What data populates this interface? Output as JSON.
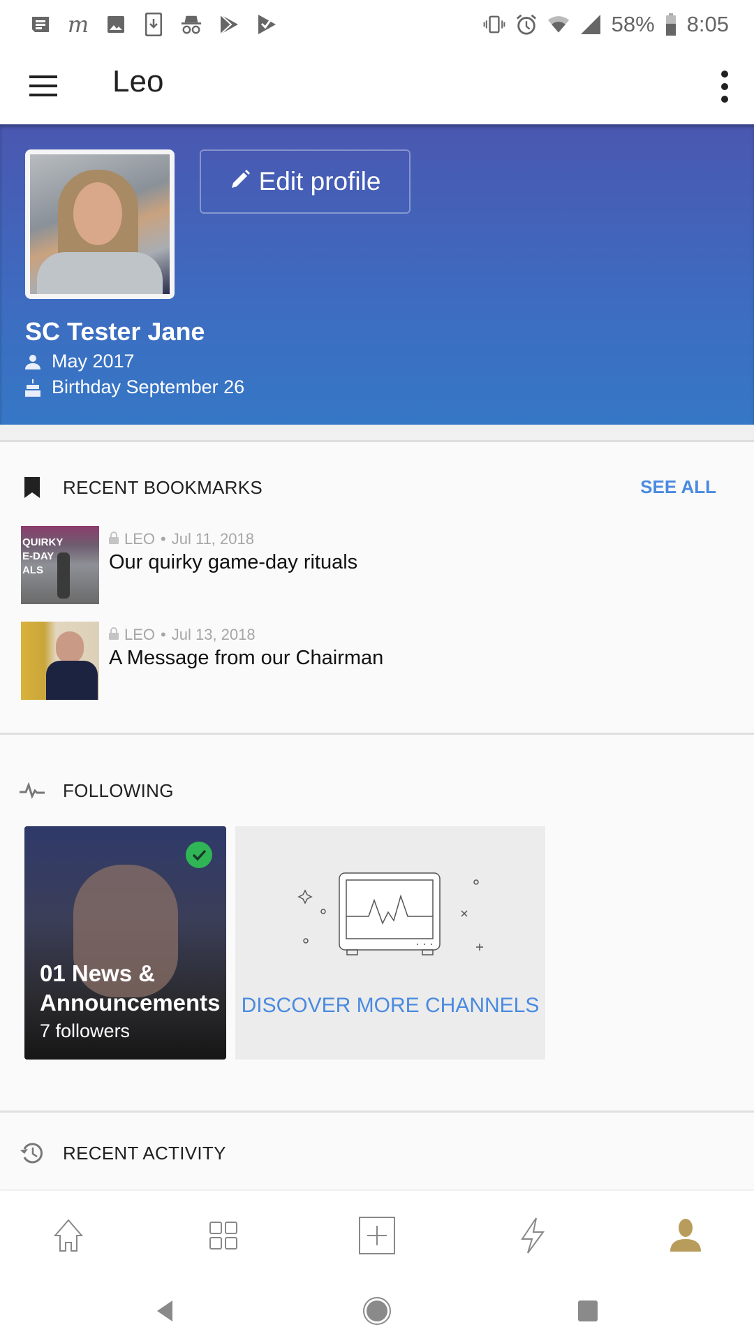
{
  "status_bar": {
    "left_icons": [
      "messages-icon",
      "medium-icon",
      "gallery-icon",
      "download-icon",
      "incognito-icon",
      "play-store-icon",
      "play-check-icon"
    ],
    "right_icons": [
      "vibrate-icon",
      "alarm-icon",
      "wifi-icon",
      "signal-icon"
    ],
    "battery": "58%",
    "time": "8:05"
  },
  "app_bar": {
    "title": "Leo",
    "menu_icon": "hamburger-menu-icon",
    "more_icon": "more-vert-icon"
  },
  "profile": {
    "name": "SC Tester Jane",
    "edit_button": "Edit profile",
    "joined": "May 2017",
    "birthday": "Birthday September 26",
    "colors": {
      "header_top": "#4a57b0",
      "header_bottom": "#3677c6"
    }
  },
  "bookmarks": {
    "heading": "RECENT BOOKMARKS",
    "see_all": "SEE ALL",
    "items": [
      {
        "source": "LEO",
        "date": "Jul 11, 2018",
        "title": "Our quirky game-day rituals",
        "thumb_text": [
          "QUIRKY",
          "E-DAY",
          "ALS"
        ]
      },
      {
        "source": "LEO",
        "date": "Jul 13, 2018",
        "title": "A Message from our Chairman"
      }
    ]
  },
  "following": {
    "heading": "FOLLOWING",
    "channels": [
      {
        "name_line1": "01 News &",
        "name_line2": "Announcements",
        "followers": "7 followers",
        "followed": true
      }
    ],
    "discover": "DISCOVER MORE CHANNELS"
  },
  "recent_activity": {
    "heading": "RECENT ACTIVITY"
  },
  "bottom_nav": {
    "items": [
      {
        "name": "home",
        "active": false
      },
      {
        "name": "channels",
        "active": false
      },
      {
        "name": "create",
        "active": false
      },
      {
        "name": "activity",
        "active": false
      },
      {
        "name": "profile",
        "active": true
      }
    ],
    "active_color": "#b79c5c"
  },
  "accent_color": "#4a8ae0"
}
